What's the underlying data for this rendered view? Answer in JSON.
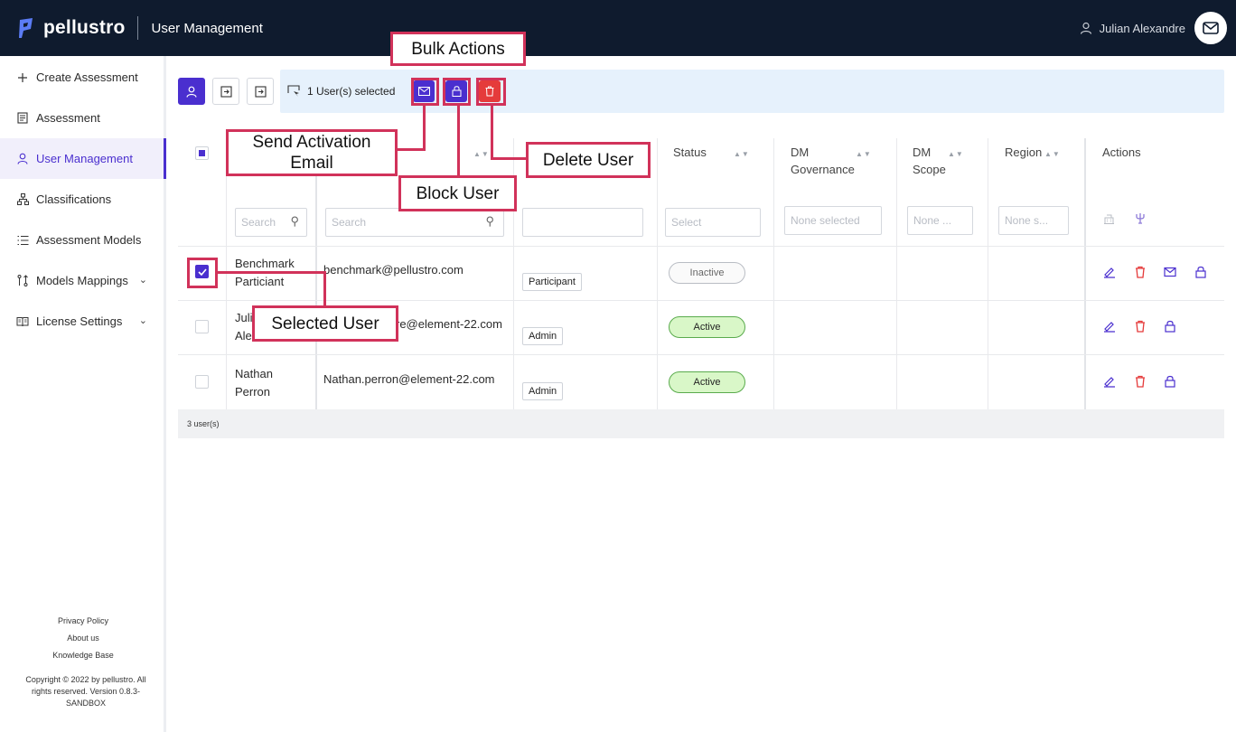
{
  "header": {
    "brand": "pellustro",
    "app_title": "User Management",
    "user_name": "Julian Alexandre"
  },
  "sidebar": {
    "items": [
      {
        "label": "Create Assessment",
        "icon": "plus-icon"
      },
      {
        "label": "Assessment",
        "icon": "document-icon"
      },
      {
        "label": "User Management",
        "icon": "user-icon",
        "active": true
      },
      {
        "label": "Classifications",
        "icon": "hierarchy-icon"
      },
      {
        "label": "Assessment Models",
        "icon": "list-icon"
      },
      {
        "label": "Models Mappings",
        "icon": "mapping-icon",
        "expandable": true
      },
      {
        "label": "License Settings",
        "icon": "book-icon",
        "expandable": true
      }
    ],
    "footer_links": [
      "Privacy Policy",
      "About us",
      "Knowledge Base"
    ],
    "copyright": "Copyright © 2022 by pellustro. All rights reserved. Version 0.8.3-SANDBOX"
  },
  "toolbar": {
    "selection_text": "1 User(s) selected"
  },
  "table": {
    "headers": {
      "status": "Status",
      "dm_governance": "DM Governance",
      "dm_scope": "DM Scope",
      "region": "Region",
      "actions": "Actions"
    },
    "filters": {
      "name": "Search",
      "email": "Search",
      "status": "Select",
      "dm_governance": "None selected",
      "dm_scope": "None ...",
      "region": "None s..."
    },
    "rows": [
      {
        "name": "Benchmark Particiant",
        "email": "benchmark@pellustro.com",
        "role": "Participant",
        "status": "Inactive",
        "checked": true
      },
      {
        "name": "Juli Ale",
        "email": "re@element-22.com",
        "role": "Admin",
        "status": "Active",
        "checked": false
      },
      {
        "name": "Nathan Perron",
        "email": "Nathan.perron@element-22.com",
        "role": "Admin",
        "status": "Active",
        "checked": false
      }
    ],
    "footer": "3 user(s)"
  },
  "annotations": {
    "bulk_actions": "Bulk Actions",
    "send_activation": "Send Activation Email",
    "delete_user": "Delete User",
    "block_user": "Block User",
    "selected_user": "Selected User"
  },
  "colors": {
    "topbar": "#0f1b2e",
    "primary": "#4a2fcf",
    "danger": "#e53b3b",
    "annotation": "#d1325a",
    "active_status": "#d9f7c8"
  }
}
